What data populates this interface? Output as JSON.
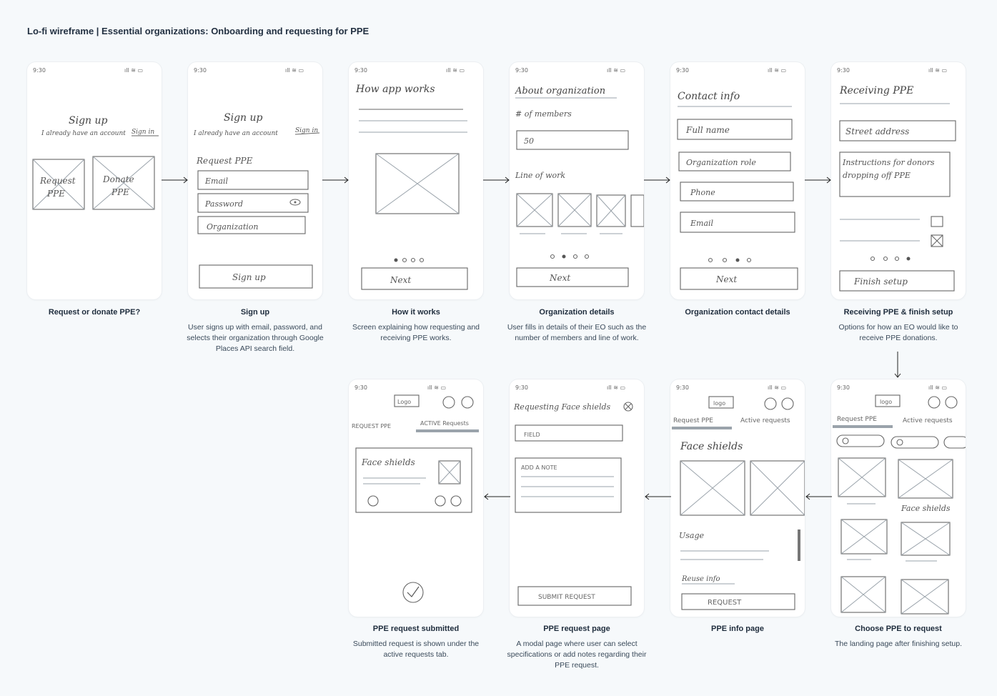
{
  "page_title": "Lo-fi wireframe | Essential organizations: Onboarding and requesting for PPE",
  "status_time": "9:30",
  "screens": [
    {
      "title": "Request or donate PPE?",
      "description": "",
      "sketch": {
        "heading": "Sign up",
        "subheading": "I already have an account",
        "signin": "Sign in",
        "option_1_line_1": "Request",
        "option_1_line_2": "PPE",
        "option_2_line_1": "Donate",
        "option_2_line_2": "PPE"
      }
    },
    {
      "title": "Sign up",
      "description": "User signs up with email, password, and selects their organization through Google Places API search field.",
      "sketch": {
        "heading": "Sign up",
        "subheading": "I already have an account",
        "signin": "Sign in",
        "section": "Request PPE",
        "field_1": "Email",
        "field_2": "Password",
        "field_3": "Organization",
        "button": "Sign up"
      }
    },
    {
      "title": "How it works",
      "description": "Screen explaining how requesting and receiving PPE works.",
      "sketch": {
        "heading": "How app works",
        "button": "Next"
      }
    },
    {
      "title": "Organization details",
      "description": "User fills in details of their EO such as the number of members and line of work.",
      "sketch": {
        "heading": "About organization",
        "label_1": "# of members",
        "value_1": "50",
        "label_2": "Line of work",
        "button": "Next"
      }
    },
    {
      "title": "Organization contact details",
      "description": "",
      "sketch": {
        "heading": "Contact info",
        "field_1": "Full name",
        "field_2": "Organization role",
        "field_3": "Phone",
        "field_4": "Email",
        "button": "Next"
      }
    },
    {
      "title": "Receiving PPE & finish setup",
      "description": "Options for how an EO would like to receive PPE donations.",
      "sketch": {
        "heading": "Receiving PPE",
        "field_1": "Street address",
        "field_2_line_1": "Instructions for donors",
        "field_2_line_2": "dropping off PPE",
        "button": "Finish setup"
      }
    },
    {
      "title": "Choose PPE to request",
      "description": "The landing page after finishing setup.",
      "sketch": {
        "logo": "logo",
        "tab_1": "Request PPE",
        "tab_2": "Active requests",
        "item_label": "Face shields"
      }
    },
    {
      "title": "PPE info page",
      "description": "",
      "sketch": {
        "logo": "logo",
        "tab_1": "Request PPE",
        "tab_2": "Active requests",
        "heading": "Face shields",
        "section_1": "Usage",
        "section_2": "Reuse info",
        "button": "REQUEST"
      }
    },
    {
      "title": "PPE request page",
      "description": "A modal page where user can select specifications or add notes regarding their PPE request.",
      "sketch": {
        "heading": "Requesting Face shields",
        "field_1": "FIELD",
        "field_2": "ADD A NOTE",
        "button": "SUBMIT REQUEST"
      }
    },
    {
      "title": "PPE request submitted",
      "description": "Submitted request is shown under the active requests tab.",
      "sketch": {
        "logo": "Logo",
        "tab_1": "REQUEST PPE",
        "tab_2": "ACTIVE Requests",
        "card_title": "Face shields"
      }
    }
  ]
}
